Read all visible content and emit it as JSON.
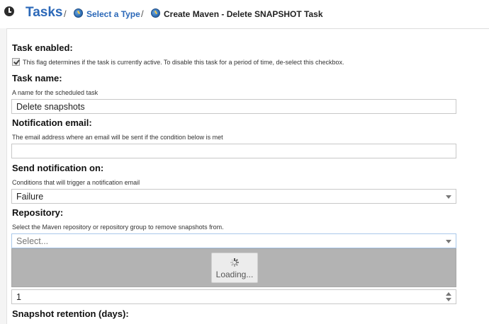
{
  "breadcrumb": {
    "root": "Tasks",
    "separator": "/",
    "step1": "Select a Type",
    "step2": "Create Maven - Delete SNAPSHOT Task"
  },
  "form": {
    "task_enabled": {
      "label": "Task enabled:",
      "checked": true,
      "help": "This flag determines if the task is currently active. To disable this task for a period of time, de-select this checkbox."
    },
    "task_name": {
      "label": "Task name:",
      "help": "A name for the scheduled task",
      "value": "Delete snapshots"
    },
    "notification_email": {
      "label": "Notification email:",
      "help": "The email address where an email will be sent if the condition below is met",
      "value": ""
    },
    "send_notification_on": {
      "label": "Send notification on:",
      "help": "Conditions that will trigger a notification email",
      "value": "Failure"
    },
    "repository": {
      "label": "Repository:",
      "help": "Select the Maven repository or repository group to remove snapshots from.",
      "placeholder": "Select..."
    },
    "min_snapshot_count": {
      "value": "1"
    },
    "snapshot_retention": {
      "label": "Snapshot retention (days):"
    }
  },
  "loading": {
    "text": "Loading..."
  },
  "colors": {
    "accent": "#2b68b8",
    "mask": "#b3b3b3"
  }
}
